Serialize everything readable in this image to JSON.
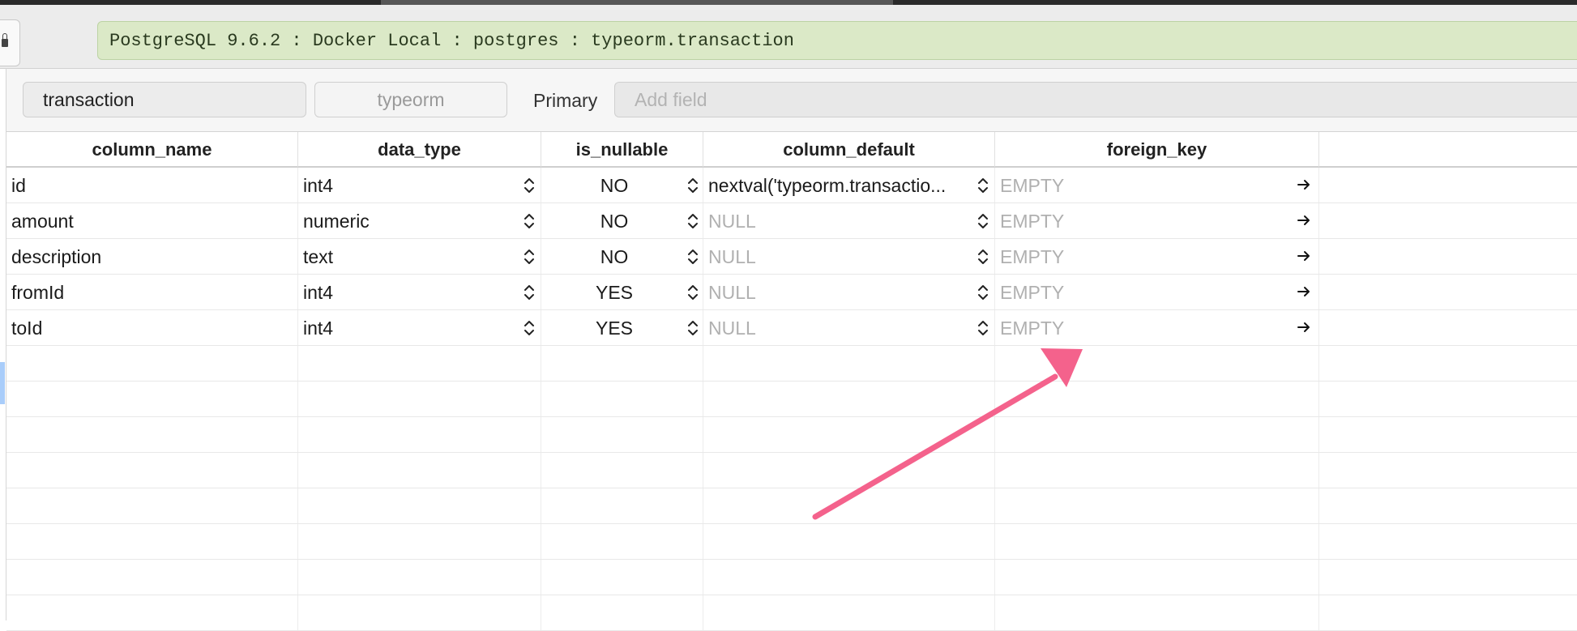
{
  "connection": {
    "status": "PostgreSQL 9.6.2 : Docker Local : postgres : typeorm.transaction"
  },
  "structure": {
    "table_name": "transaction",
    "schema": "typeorm",
    "primary_label": "Primary",
    "add_field_placeholder": "Add field"
  },
  "grid": {
    "headers": [
      "column_name",
      "data_type",
      "is_nullable",
      "column_default",
      "foreign_key"
    ],
    "rows": [
      {
        "column_name": "id",
        "data_type": "int4",
        "is_nullable": "NO",
        "column_default": "nextval('typeorm.transactio...",
        "column_default_empty": false,
        "foreign_key": "EMPTY"
      },
      {
        "column_name": "amount",
        "data_type": "numeric",
        "is_nullable": "NO",
        "column_default": "NULL",
        "column_default_empty": true,
        "foreign_key": "EMPTY"
      },
      {
        "column_name": "description",
        "data_type": "text",
        "is_nullable": "NO",
        "column_default": "NULL",
        "column_default_empty": true,
        "foreign_key": "EMPTY"
      },
      {
        "column_name": "fromId",
        "data_type": "int4",
        "is_nullable": "YES",
        "column_default": "NULL",
        "column_default_empty": true,
        "foreign_key": "EMPTY"
      },
      {
        "column_name": "toId",
        "data_type": "int4",
        "is_nullable": "YES",
        "column_default": "NULL",
        "column_default_empty": true,
        "foreign_key": "EMPTY"
      }
    ],
    "empty_rows": 8
  },
  "icons": {
    "stepper": "up-down-stepper-icon",
    "foreign_key_link": "arrow-right-icon",
    "lock": "lock-icon"
  },
  "colors": {
    "status_bg": "#dbe9c7",
    "annotation_arrow": "#f4628c",
    "placeholder": "#b0b0b0"
  }
}
